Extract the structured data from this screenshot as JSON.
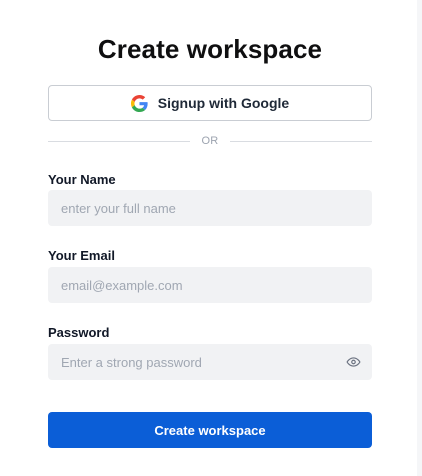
{
  "form": {
    "title": "Create workspace",
    "google_button": {
      "label": "Signup with Google",
      "icon": "google-icon"
    },
    "divider_text": "OR",
    "fields": {
      "name": {
        "label": "Your Name",
        "placeholder": "enter your full name",
        "value": ""
      },
      "email": {
        "label": "Your Email",
        "placeholder": "email@example.com",
        "value": ""
      },
      "password": {
        "label": "Password",
        "placeholder": "Enter a strong password",
        "value": "",
        "toggle_icon": "eye-icon"
      }
    },
    "submit_label": "Create workspace"
  },
  "colors": {
    "primary": "#0b5ed7",
    "input_background": "#f1f2f4",
    "border": "#c9cdd3",
    "placeholder": "#a0a7b2"
  }
}
